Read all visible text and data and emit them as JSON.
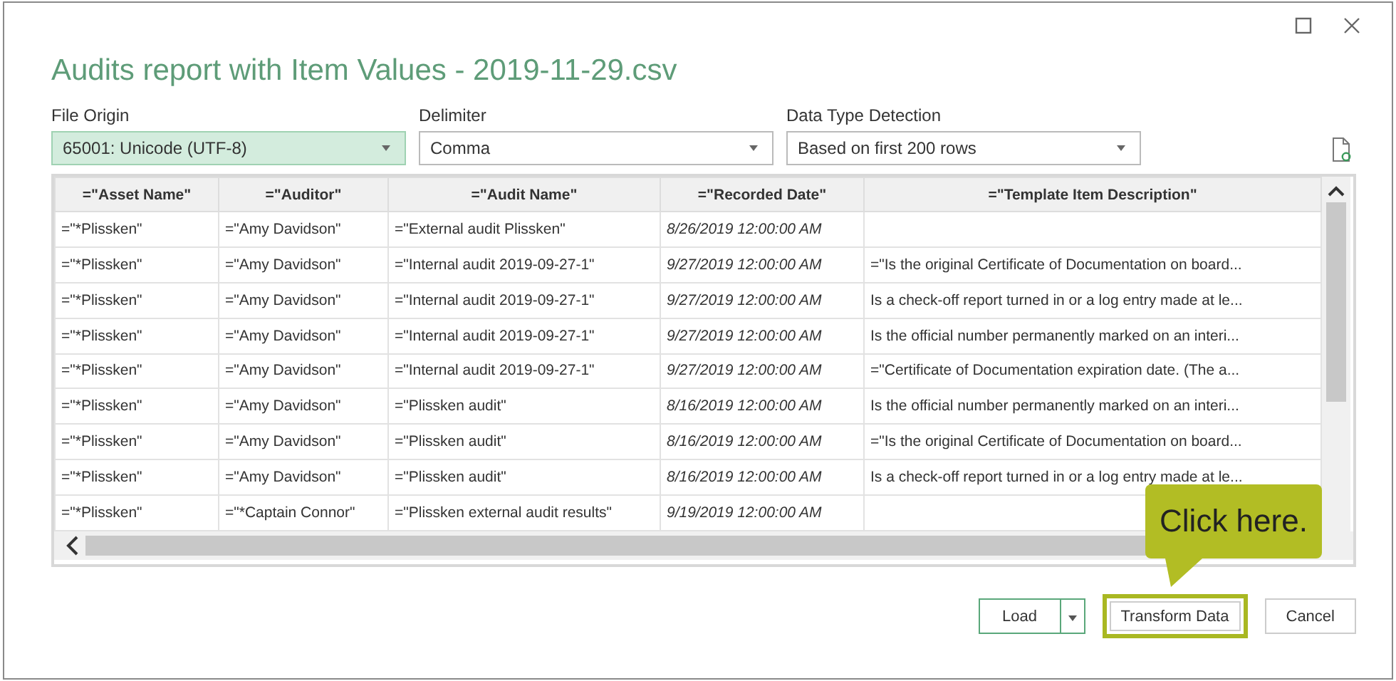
{
  "window": {
    "title": "Audits report with Item Values - 2019-11-29.csv"
  },
  "options": [
    {
      "label": "File Origin",
      "value": "65001: Unicode (UTF-8)",
      "focused": true
    },
    {
      "label": "Delimiter",
      "value": "Comma",
      "focused": false
    },
    {
      "label": "Data Type Detection",
      "value": "Based on first 200 rows",
      "focused": false
    }
  ],
  "table": {
    "columns": [
      "=\"Asset Name\"",
      "=\"Auditor\"",
      "=\"Audit Name\"",
      "=\"Recorded Date\"",
      "=\"Template Item Description\""
    ],
    "rows": [
      {
        "asset": "=\"*Plissken\"",
        "auditor": "=\"Amy Davidson\"",
        "audit": "=\"External audit Plissken\"",
        "date": "8/26/2019 12:00:00 AM"
      },
      {
        "asset": "=\"*Plissken\"",
        "auditor": "=\"Amy Davidson\"",
        "audit": "=\"Internal audit 2019-09-27-1\"",
        "date": "9/27/2019 12:00:00 AM",
        "description": "=\"Is the original Certificate of Documentation on board..."
      },
      {
        "asset": "=\"*Plissken\"",
        "auditor": "=\"Amy Davidson\"",
        "audit": "=\"Internal audit 2019-09-27-1\"",
        "date": "9/27/2019 12:00:00 AM",
        "description": "Is a check-off report turned in or a log entry made at le..."
      },
      {
        "asset": "=\"*Plissken\"",
        "auditor": "=\"Amy Davidson\"",
        "audit": "=\"Internal audit 2019-09-27-1\"",
        "date": "9/27/2019 12:00:00 AM",
        "description": "Is the official number permanently marked on an interi..."
      },
      {
        "asset": "=\"*Plissken\"",
        "auditor": "=\"Amy Davidson\"",
        "audit": "=\"Internal audit 2019-09-27-1\"",
        "date": "9/27/2019 12:00:00 AM",
        "description": "=\"Certificate of Documentation expiration date. (The a..."
      },
      {
        "asset": "=\"*Plissken\"",
        "auditor": "=\"Amy Davidson\"",
        "audit": "=\"Plissken audit\"",
        "date": "8/16/2019 12:00:00 AM",
        "description": "Is the official number permanently marked on an interi..."
      },
      {
        "asset": "=\"*Plissken\"",
        "auditor": "=\"Amy Davidson\"",
        "audit": "=\"Plissken audit\"",
        "date": "8/16/2019 12:00:00 AM",
        "description": "=\"Is the original Certificate of Documentation on board..."
      },
      {
        "asset": "=\"*Plissken\"",
        "auditor": "=\"Amy Davidson\"",
        "audit": "=\"Plissken audit\"",
        "date": "8/16/2019 12:00:00 AM",
        "description": "Is a check-off report turned in or a log entry made at le..."
      },
      {
        "asset": "=\"*Plissken\"",
        "auditor": "=\"*Captain Connor\"",
        "audit": "=\"Plissken external audit results\"",
        "date": "9/19/2019 12:00:00 AM"
      }
    ]
  },
  "callout": {
    "text": "Click here."
  },
  "buttons": [
    {
      "label": "Load",
      "kind": "split",
      "highlighted": false
    },
    {
      "label": "Transform Data",
      "kind": "plain",
      "highlighted": true
    },
    {
      "label": "Cancel",
      "kind": "plain",
      "highlighted": false
    }
  ]
}
